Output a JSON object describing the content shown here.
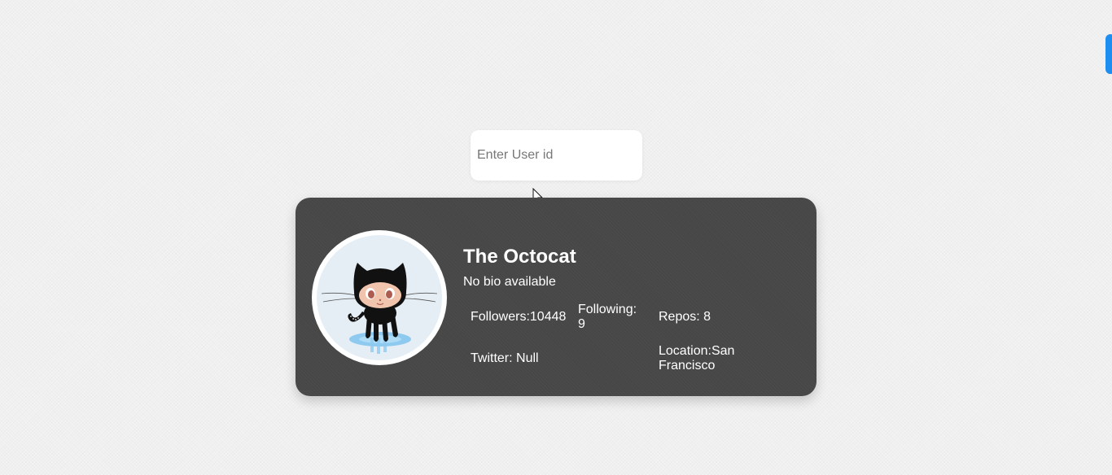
{
  "search": {
    "placeholder": "Enter User id",
    "value": ""
  },
  "profile": {
    "name": "The Octocat",
    "bio": "No bio available",
    "avatar_icon": "octocat-avatar",
    "followers": "Followers:10448",
    "following": "Following: 9",
    "repos": "Repos: 8",
    "twitter": "Twitter: Null",
    "location": "Location:San Francisco"
  },
  "colors": {
    "card_background": "#474747",
    "edge_tab": "#1f8ef1",
    "page_background": "#f3f3f3"
  }
}
